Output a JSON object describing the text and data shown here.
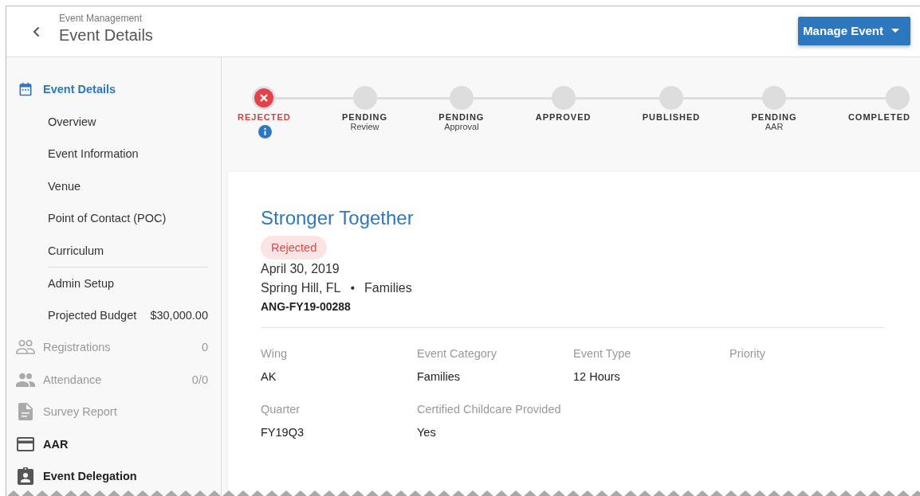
{
  "header": {
    "breadcrumb": "Event Management",
    "title": "Event Details",
    "action": "Manage Event"
  },
  "sidebar": {
    "items": [
      {
        "kind": "section",
        "label": "Event Details",
        "selected": true,
        "disabled": false,
        "children": [
          {
            "label": "Overview",
            "separated": false
          },
          {
            "label": "Event Information",
            "separated": false
          },
          {
            "label": "Venue",
            "separated": false
          },
          {
            "label": "Point of Contact (POC)",
            "separated": false
          },
          {
            "label": "Curriculum",
            "separated": false
          },
          {
            "label": "Admin Setup",
            "separated": true
          },
          {
            "label": "Projected Budget",
            "value": "$30,000.00",
            "separated": false
          }
        ]
      },
      {
        "kind": "section",
        "label": "Registrations",
        "value": "0",
        "selected": false,
        "disabled": true
      },
      {
        "kind": "section",
        "label": "Attendance",
        "value": "0/0",
        "selected": false,
        "disabled": true
      },
      {
        "kind": "section",
        "label": "Survey Report",
        "selected": false,
        "disabled": true
      },
      {
        "kind": "section",
        "label": "AAR",
        "selected": false,
        "disabled": false
      },
      {
        "kind": "section",
        "label": "Event Delegation",
        "selected": false,
        "disabled": false
      }
    ]
  },
  "stepper": {
    "steps": [
      {
        "label": "REJECTED",
        "error": true,
        "info": true
      },
      {
        "label": "PENDING",
        "sublabel": "Review",
        "error": false,
        "info": false
      },
      {
        "label": "PENDING",
        "sublabel": "Approval",
        "error": false,
        "info": false
      },
      {
        "label": "APPROVED",
        "error": false,
        "info": false
      },
      {
        "label": "PUBLISHED",
        "error": false,
        "info": false
      },
      {
        "label": "PENDING",
        "sublabel": "AAR",
        "error": false,
        "info": false
      },
      {
        "label": "COMPLETED",
        "error": false,
        "info": false
      }
    ]
  },
  "event": {
    "title": "Stronger Together",
    "status": "Rejected",
    "date": "April 30, 2019",
    "location": "Spring Hill, FL",
    "separator": "•",
    "category": "Families",
    "code": "ANG-FY19-00288",
    "fields": [
      {
        "label": "Wing",
        "value": "AK"
      },
      {
        "label": "Event Category",
        "value": "Families"
      },
      {
        "label": "Event Type",
        "value": "12 Hours"
      },
      {
        "label": "Priority"
      },
      {
        "label": "Quarter",
        "value": "FY19Q3"
      },
      {
        "label": "Certified Childcare Provided",
        "value": "Yes"
      }
    ]
  }
}
